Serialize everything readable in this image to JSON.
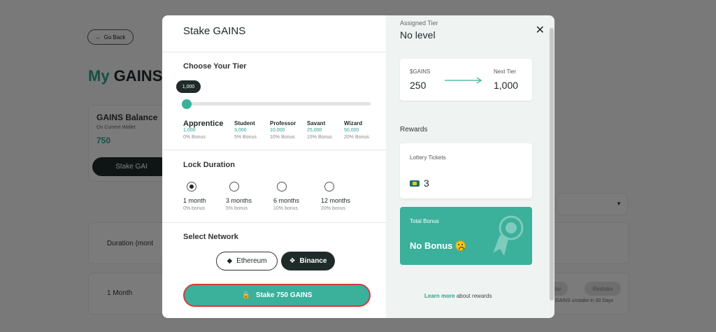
{
  "background": {
    "go_back": "Go Back",
    "title_accent": "My",
    "title_rest": "GAINS",
    "balance_title": "GAINS Balance",
    "balance_subtitle": "On Current Wallet",
    "balance_value": "750",
    "stake_button": "Stake GAI",
    "duration_head": "Duration (mont",
    "row_value": "1 Month",
    "pill_1": "ew",
    "pill_2": "Restake",
    "unstake_note": "GAINS unstake in 30 Days"
  },
  "modal": {
    "title": "Stake GAINS",
    "choose_tier": "Choose Your Tier",
    "slider": {
      "tooltip": "1,000",
      "value_fraction": 0.0
    },
    "tiers": [
      {
        "name": "Apprentice",
        "value": "1,000",
        "bonus": "0% Bonus"
      },
      {
        "name": "Student",
        "value": "3,000",
        "bonus": "5% Bonus"
      },
      {
        "name": "Professor",
        "value": "10,000",
        "bonus": "10% Bonus"
      },
      {
        "name": "Savant",
        "value": "25,000",
        "bonus": "15% Bonus"
      },
      {
        "name": "Wizard",
        "value": "50,000",
        "bonus": "20% Bonus"
      }
    ],
    "lock_duration": "Lock Duration",
    "durations": [
      {
        "label": "1 month",
        "bonus": "0% bonus",
        "selected": true
      },
      {
        "label": "3 months",
        "bonus": "5% bonus",
        "selected": false
      },
      {
        "label": "6 months",
        "bonus": "10% bonus",
        "selected": false
      },
      {
        "label": "12 months",
        "bonus": "20% bonus",
        "selected": false
      }
    ],
    "select_network": "Select Network",
    "networks": {
      "ethereum": "Ethereum",
      "binance": "Binance",
      "selected": "Binance"
    },
    "stake_button": "Stake 750 GAINS",
    "close_icon": "close-icon"
  },
  "panel": {
    "assigned_tier_label": "Assigned Tier",
    "assigned_tier_value": "No level",
    "gains_label": "$GAINS",
    "gains_value": "250",
    "next_tier_label": "Next Tier",
    "next_tier_value": "1,000",
    "rewards_label": "Rewards",
    "lottery_label": "Lottery Tickets",
    "lottery_value": "3",
    "bonus_label": "Total Bonus",
    "bonus_value": "No Bonus",
    "learn_more": "Learn more",
    "learn_rest": "about rewards"
  },
  "colors": {
    "accent": "#3bb09b",
    "dark": "#1e2b29",
    "highlight_border": "#d43c3c"
  }
}
